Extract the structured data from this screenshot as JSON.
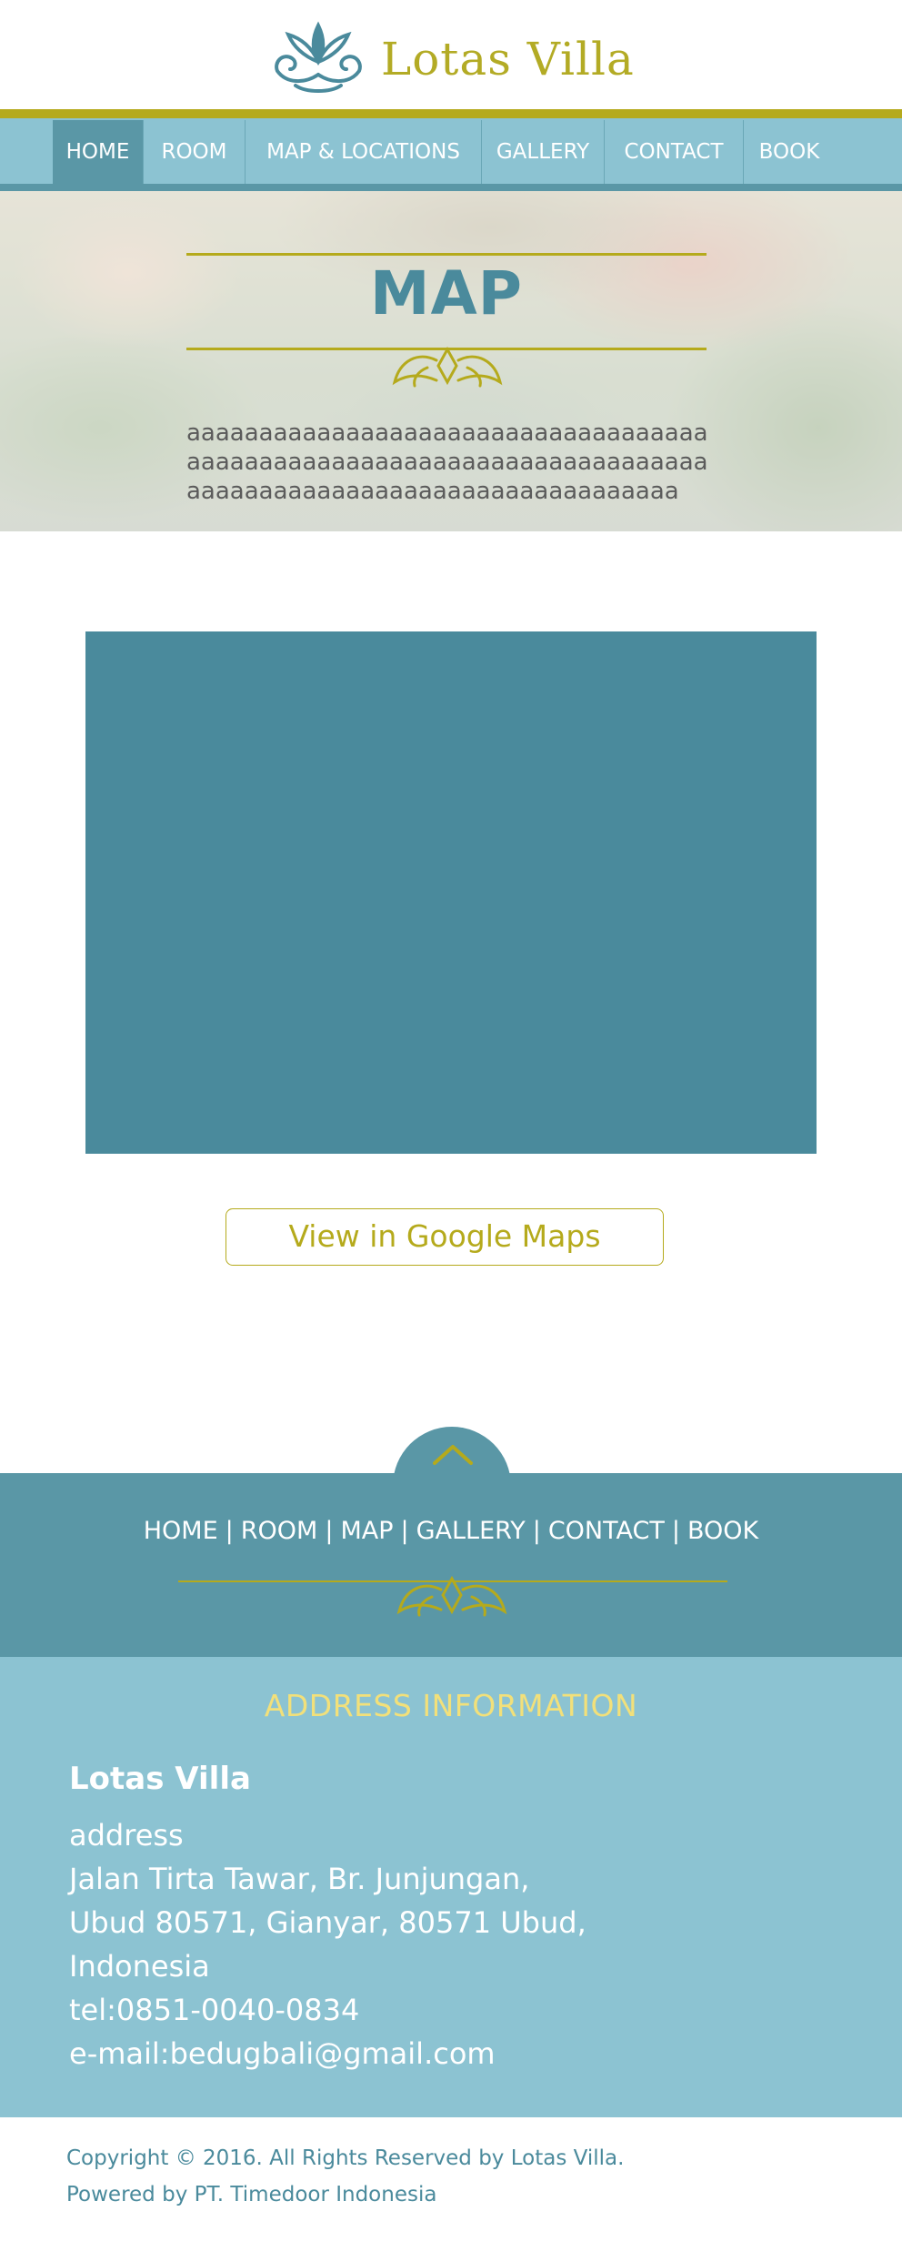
{
  "brand": {
    "name": "Lotas Villa",
    "logo_icon": "lotus-icon",
    "accent_gold": "#b5aa1c",
    "accent_teal": "#4a8a9c",
    "nav_blue": "#8cc3d2"
  },
  "nav": {
    "items": [
      {
        "label": "HOME",
        "active": true
      },
      {
        "label": "ROOM",
        "active": false
      },
      {
        "label": "MAP &  LOCATIONS",
        "active": false
      },
      {
        "label": "GALLERY",
        "active": false
      },
      {
        "label": "CONTACT",
        "active": false
      },
      {
        "label": "BOOK",
        "active": false
      }
    ]
  },
  "hero": {
    "title": "MAP",
    "text": "aaaaaaaaaaaaaaaaaaaaaaaaaaaaaaaaaaaaaaaaaaaaaaaaaaaaaaaaaaaaaaaaaaaaaaaaaaaaaaaaaaaaaaaaaaaaaaaaaaaaaaaaaa"
  },
  "map": {
    "button_label": "View in Google Maps"
  },
  "footer_nav": {
    "up_icon": "chevron-up-icon",
    "items": [
      "HOME",
      "ROOM",
      "MAP",
      "GALLERY ",
      "CONTACT",
      "BOOK"
    ],
    "separator": "|"
  },
  "address": {
    "title": "ADDRESS INFORMATION",
    "name": "Lotas Villa",
    "lines": [
      "address",
      "Jalan Tirta Tawar, Br. Junjungan,",
      "Ubud 80571, Gianyar, 80571 Ubud,",
      "Indonesia",
      "tel:0851-0040-0834",
      "e-mail:bedugbali@gmail.com"
    ]
  },
  "copyright": {
    "line1": "Copyright © 2016. All Rights Reserved by Lotas Villa.",
    "line2": "Powered by PT. Timedoor Indonesia"
  }
}
